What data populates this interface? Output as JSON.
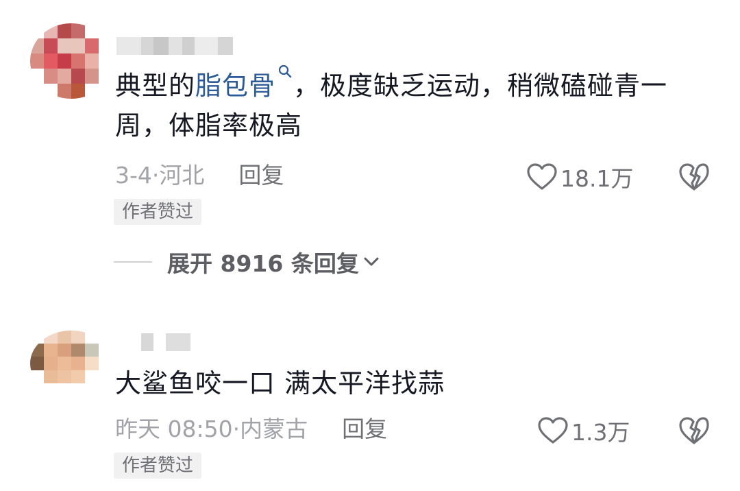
{
  "comments": [
    {
      "text_before": "典型的",
      "link": "脂包骨",
      "text_after": "，极度缺乏运动，稍微磕碰青一周，体脂率极高",
      "date": "3-4",
      "location": "河北",
      "reply_label": "回复",
      "likes": "18.1万",
      "badge": "作者赞过",
      "expand_label": "展开 8916 条回复"
    },
    {
      "text": "大鲨鱼咬一口 满太平洋找蒜",
      "date": "昨天 08:50",
      "location": "内蒙古",
      "reply_label": "回复",
      "likes": "1.3万",
      "badge": "作者赞过"
    }
  ],
  "colors": {
    "link": "#2d5b97",
    "meta": "#a1a3a8",
    "badge_bg": "#f1f1f2"
  },
  "icons": [
    "search-icon",
    "heart-icon",
    "broken-heart-icon",
    "chevron-down-icon"
  ]
}
